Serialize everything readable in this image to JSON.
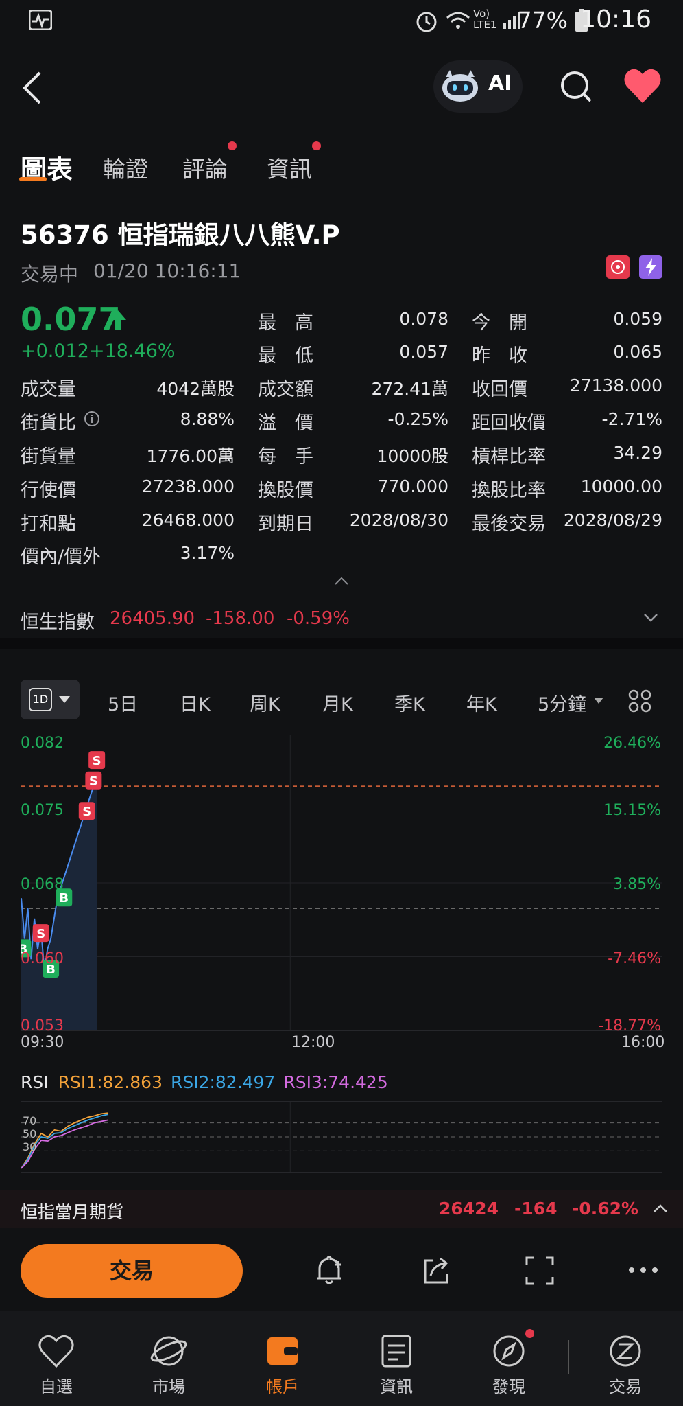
{
  "status_bar": {
    "battery": "77%",
    "time": "10:16",
    "network": "Vo) LTE1"
  },
  "header": {
    "ai_label": "AI"
  },
  "tabs": [
    {
      "label": "圖表"
    },
    {
      "label": "輪證"
    },
    {
      "label": "評論"
    },
    {
      "label": "資訊"
    }
  ],
  "stock": {
    "title": "56376  恒指瑞銀八八熊V.P",
    "status": "交易中",
    "datetime": "01/20 10:16:11",
    "price": "0.077",
    "change": "+0.012",
    "change_pct": "+18.46%"
  },
  "quote": {
    "high_label": "最　高",
    "high": "0.078",
    "open_label": "今　開",
    "open": "0.059",
    "low_label": "最　低",
    "low": "0.057",
    "prev_close_label": "昨　收",
    "prev_close": "0.065",
    "volume_label": "成交量",
    "volume": "4042萬股",
    "turnover_label": "成交額",
    "turnover": "272.41萬",
    "callback_label": "收回價",
    "callback": "27138.000",
    "street_ratio_label": "街貨比",
    "street_ratio": "8.88%",
    "premium_label": "溢　價",
    "premium": "-0.25%",
    "dist_callback_label": "距回收價",
    "dist_callback": "-2.71%",
    "street_qty_label": "街貨量",
    "street_qty": "1776.00萬",
    "lot_label": "每　手",
    "lot": "10000股",
    "leverage_label": "槓桿比率",
    "leverage": "34.29",
    "strike_label": "行使價",
    "strike": "27238.000",
    "conv_price_label": "換股價",
    "conv_price": "770.000",
    "conv_ratio_label": "換股比率",
    "conv_ratio": "10000.00",
    "breakeven_label": "打和點",
    "breakeven": "26468.000",
    "expiry_label": "到期日",
    "expiry": "2028/08/30",
    "last_trade_label": "最後交易",
    "last_trade": "2028/08/29",
    "moneyness_label": "價內/價外",
    "moneyness": "3.17%"
  },
  "hsi": {
    "label": "恒生指數",
    "value": "26405.90",
    "change": "-158.00",
    "pct": "-0.59%"
  },
  "chart_tabs": [
    "5日",
    "日K",
    "周K",
    "月K",
    "季K",
    "年K",
    "5分鐘"
  ],
  "chart_tab_selected": "1D",
  "chart_data": {
    "type": "line",
    "y_left_ticks": [
      "0.082",
      "0.075",
      "0.068",
      "0.060",
      "0.053"
    ],
    "y_right_ticks": [
      "26.46%",
      "15.15%",
      "3.85%",
      "-7.46%",
      "-18.77%"
    ],
    "x_ticks": [
      "09:30",
      "12:00",
      "16:00"
    ],
    "ylim": [
      0.053,
      0.082
    ],
    "x": [
      0,
      2,
      4,
      6,
      8,
      10,
      12,
      14,
      16,
      18,
      20,
      22,
      24,
      26,
      28,
      30,
      32,
      34,
      36,
      38,
      40,
      42,
      44,
      46
    ],
    "values": [
      0.066,
      0.062,
      0.065,
      0.06,
      0.064,
      0.061,
      0.063,
      0.059,
      0.061,
      0.062,
      0.064,
      0.066,
      0.067,
      0.068,
      0.069,
      0.07,
      0.071,
      0.072,
      0.073,
      0.074,
      0.075,
      0.076,
      0.077,
      0.078
    ],
    "prev_close": 0.065,
    "current": 0.077,
    "markers": [
      {
        "x": 1,
        "label": "B",
        "value": 0.061
      },
      {
        "x": 12,
        "label": "S",
        "value": 0.0625
      },
      {
        "x": 18,
        "label": "B",
        "value": 0.059
      },
      {
        "x": 26,
        "label": "B",
        "value": 0.066
      },
      {
        "x": 40,
        "label": "S",
        "value": 0.0745
      },
      {
        "x": 44,
        "label": "S",
        "value": 0.0775
      },
      {
        "x": 46,
        "label": "S",
        "value": 0.0795
      }
    ],
    "total_x": 390
  },
  "rsi": {
    "label": "RSI",
    "rsi1": "RSI1:82.863",
    "rsi2": "RSI2:82.497",
    "rsi3": "RSI3:74.425",
    "levels": [
      "70",
      "50",
      "30"
    ]
  },
  "futures": {
    "label": "恒指當月期貨",
    "value": "26424",
    "change": "-164",
    "pct": "-0.62%"
  },
  "actions": {
    "trade": "交易"
  },
  "nav": [
    {
      "label": "自選"
    },
    {
      "label": "市場"
    },
    {
      "label": "帳戶"
    },
    {
      "label": "資訊"
    },
    {
      "label": "發現"
    },
    {
      "label": "交易"
    }
  ],
  "colors": {
    "accent": "#f37a1f",
    "up": "#1fae5b",
    "down": "#e5394c",
    "rsi1": "#f3a23a",
    "rsi2": "#3ba7e6",
    "rsi3": "#d46be0"
  }
}
